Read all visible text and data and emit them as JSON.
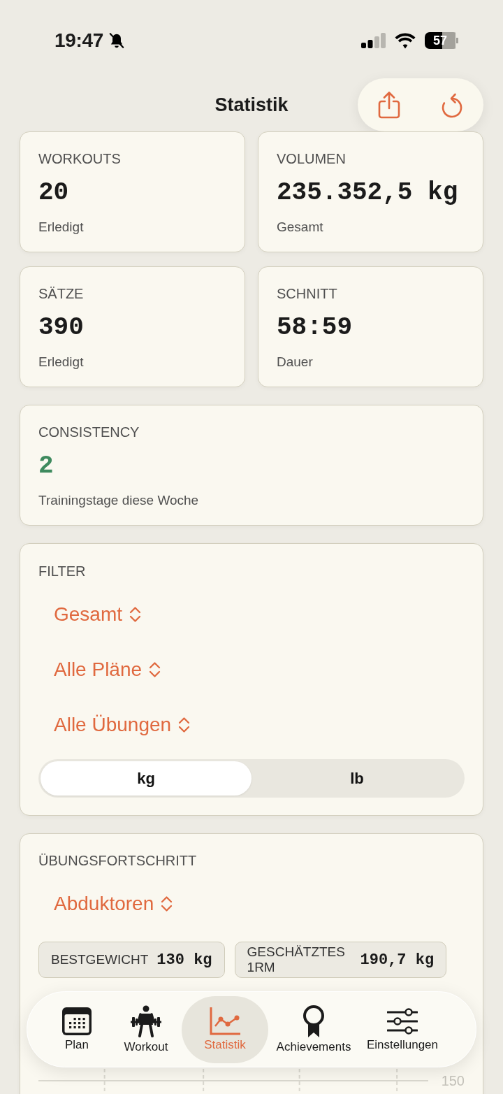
{
  "status_bar": {
    "time": "19:47",
    "silent": true,
    "battery": "57"
  },
  "header": {
    "title": "Statistik",
    "actions": [
      {
        "kind": "share"
      },
      {
        "kind": "reset"
      }
    ]
  },
  "stats": [
    {
      "label": "WORKOUTS",
      "value": "20",
      "caption": "Erledigt"
    },
    {
      "label": "VOLUMEN",
      "value": "235.352,5 kg",
      "caption": "Gesamt"
    },
    {
      "label": "SÄTZE",
      "value": "390",
      "caption": "Erledigt"
    },
    {
      "label": "SCHNITT",
      "value": "58:59",
      "caption": "Dauer"
    }
  ],
  "consistency": {
    "label": "CONSISTENCY",
    "value": "2",
    "caption": "Trainingstage diese Woche"
  },
  "filter": {
    "label": "FILTER",
    "pickers": [
      "Gesamt",
      "Alle Pläne",
      "Alle Übungen"
    ],
    "units": [
      {
        "label": "kg",
        "selected": true
      },
      {
        "label": "lb",
        "selected": false
      }
    ]
  },
  "progress": {
    "label": "ÜBUNGSFORTSCHRITT",
    "exercise": "Abduktoren",
    "badges": [
      {
        "label": "BESTGEWICHT",
        "value": "130 kg"
      },
      {
        "label": "GESCHÄTZTES 1RM",
        "value": "190,7 kg"
      }
    ],
    "chart_tick": "150"
  },
  "tab_bar": [
    {
      "kind": "calendar",
      "label": "Plan",
      "selected": false
    },
    {
      "kind": "lifter",
      "label": "Workout",
      "selected": false
    },
    {
      "kind": "chart",
      "label": "Statistik",
      "selected": true
    },
    {
      "kind": "award",
      "label": "Achievements",
      "selected": false
    },
    {
      "kind": "sliders",
      "label": "Einstellungen",
      "selected": false
    }
  ]
}
